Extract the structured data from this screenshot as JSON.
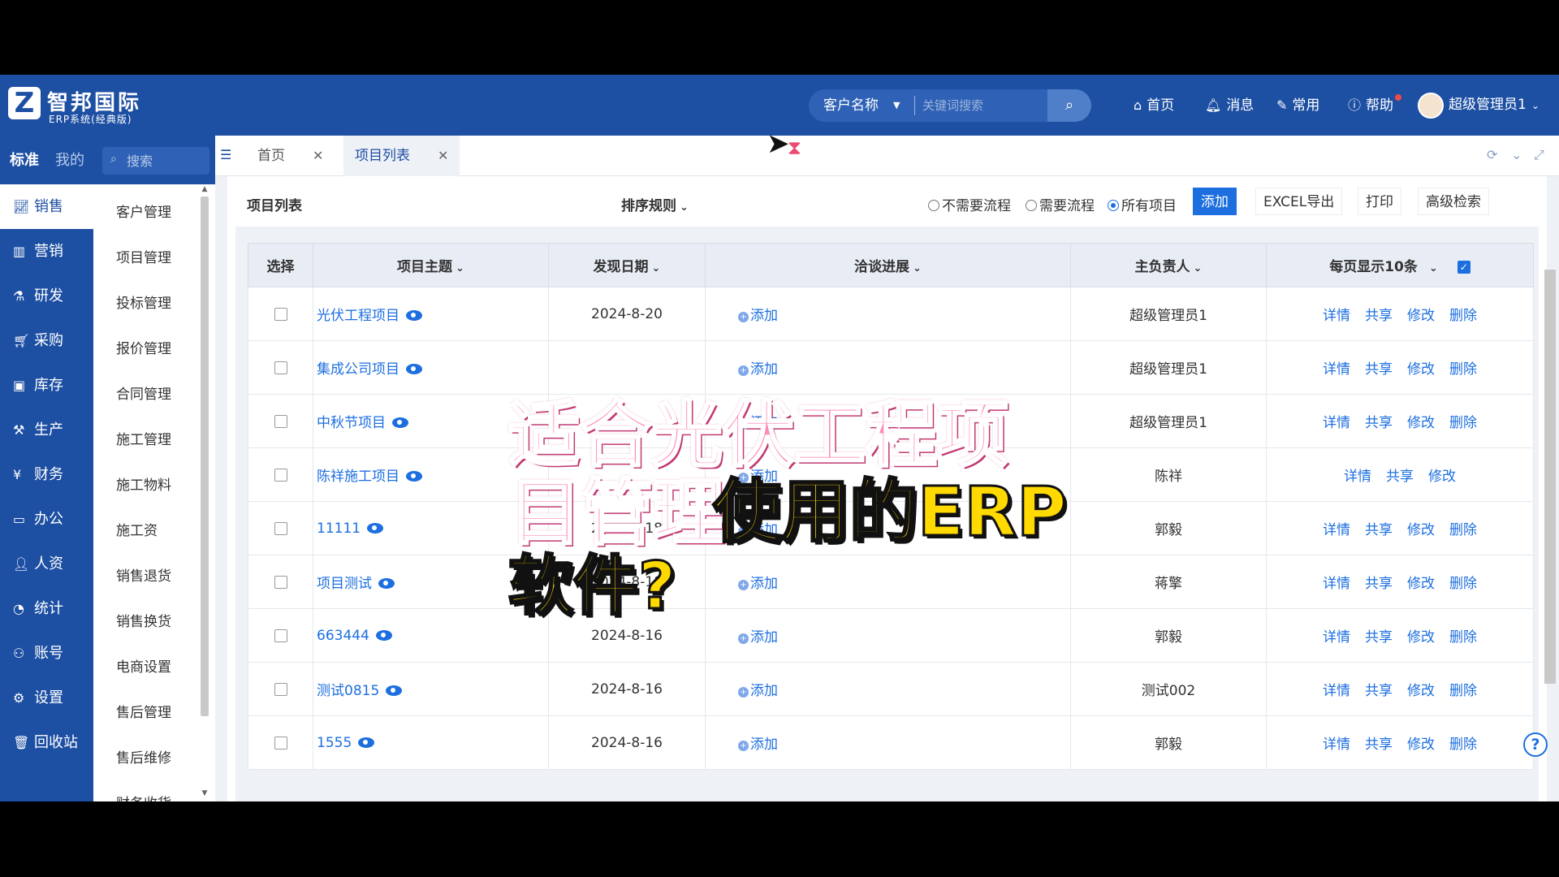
{
  "header": {
    "logo_letter": "Z",
    "brand_title": "智邦国际",
    "brand_subtitle": "ERP系统(经典版)",
    "search_field": "客户名称",
    "search_placeholder": "关键词搜索",
    "nav": [
      {
        "label": "首页",
        "icon": "home-icon"
      },
      {
        "label": "消息",
        "icon": "bell-icon"
      },
      {
        "label": "常用",
        "icon": "wrench-icon"
      },
      {
        "label": "帮助",
        "icon": "question-icon"
      }
    ],
    "user": "超级管理员1"
  },
  "sidebar": {
    "tabs": [
      "标准",
      "我的"
    ],
    "search_placeholder": "搜索",
    "menu1": [
      "销售",
      "营销",
      "研发",
      "采购",
      "库存",
      "生产",
      "财务",
      "办公",
      "人资",
      "统计",
      "账号",
      "设置",
      "回收站"
    ],
    "menu2": [
      "客户管理",
      "项目管理",
      "投标管理",
      "报价管理",
      "合同管理",
      "施工管理",
      "施工物料",
      "施工资",
      "销售退货",
      "销售换货",
      "电商设置",
      "售后管理",
      "售后维修",
      "财务收货"
    ]
  },
  "tabs": [
    {
      "label": "首页"
    },
    {
      "label": "项目列表",
      "active": true
    }
  ],
  "content": {
    "title": "项目列表",
    "sort_rule": "排序规则",
    "radios": [
      {
        "label": "不需要流程",
        "checked": false
      },
      {
        "label": "需要流程",
        "checked": false
      },
      {
        "label": "所有项目",
        "checked": true
      }
    ],
    "buttons": [
      "添加",
      "EXCEL导出",
      "打印",
      "高级检索"
    ],
    "columns": {
      "select": "选择",
      "subject": "项目主题",
      "date": "发现日期",
      "progress": "洽谈进展",
      "owner": "主负责人",
      "page_size": "每页显示10条"
    },
    "add_label": "添加",
    "ops": [
      "详情",
      "共享",
      "修改",
      "删除"
    ],
    "rows": [
      {
        "subject": "光伏工程项目",
        "date": "2024-8-20",
        "owner": "超级管理员1",
        "can_delete": true
      },
      {
        "subject": "集成公司项目",
        "date": "",
        "owner": "超级管理员1",
        "can_delete": true
      },
      {
        "subject": "中秋节项目",
        "date": "",
        "owner": "超级管理员1",
        "can_delete": true
      },
      {
        "subject": "陈祥施工项目",
        "date": "",
        "owner": "陈祥",
        "can_delete": false
      },
      {
        "subject": "11111",
        "date": "2024-8-18",
        "owner": "郭毅",
        "can_delete": true
      },
      {
        "subject": "项目测试",
        "date": "2024-8-18",
        "owner": "蒋擎",
        "can_delete": true
      },
      {
        "subject": "663444",
        "date": "2024-8-16",
        "owner": "郭毅",
        "can_delete": true
      },
      {
        "subject": "测试0815",
        "date": "2024-8-16",
        "owner": "测试002",
        "can_delete": true
      },
      {
        "subject": "1555",
        "date": "2024-8-16",
        "owner": "郭毅",
        "can_delete": true
      }
    ]
  },
  "overlay": {
    "line1": "适合光伏工程项",
    "line2a": "目管理",
    "line2b": "使用的ERP",
    "line3": "软件?"
  },
  "colors": {
    "brand": "#1d4fa3",
    "accent": "#1d6fe0",
    "caption_pink": "#ff8ab7",
    "caption_yellow": "#ffd900"
  }
}
